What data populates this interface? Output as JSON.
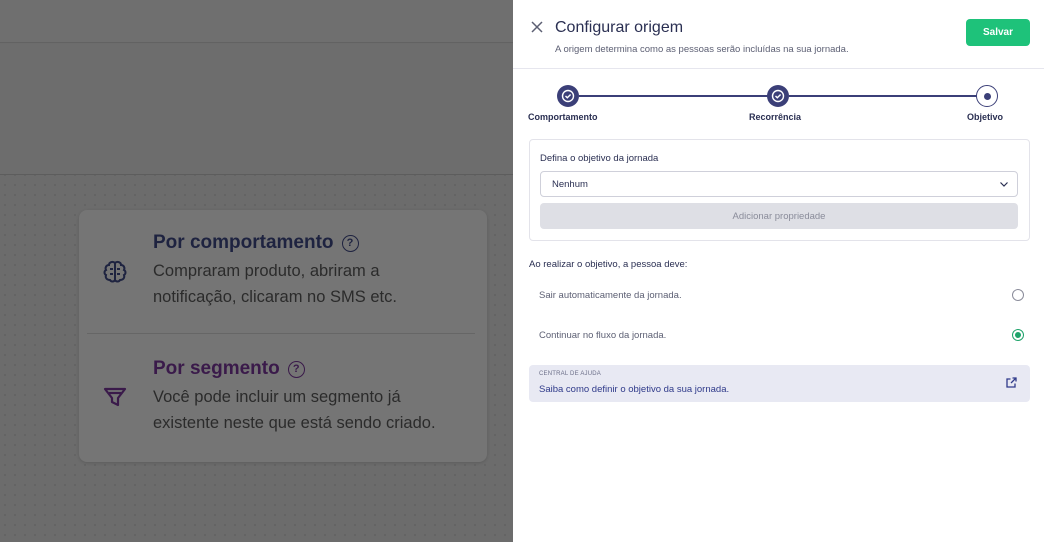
{
  "background": {
    "options": [
      {
        "title": "Por comportamento",
        "description": "Compraram produto, abriram a notificação, clicaram no SMS etc.",
        "icon": "brain-icon"
      },
      {
        "title": "Por segmento",
        "description": "Você pode incluir um segmento já existente neste que está sendo criado.",
        "icon": "funnel-icon"
      }
    ],
    "help_icon": "?"
  },
  "drawer": {
    "title": "Configurar origem",
    "subtitle": "A origem determina como as pessoas serão incluídas na sua jornada.",
    "save_label": "Salvar",
    "steps": [
      {
        "label": "Comportamento",
        "state": "done"
      },
      {
        "label": "Recorrência",
        "state": "done"
      },
      {
        "label": "Objetivo",
        "state": "current"
      }
    ],
    "objective": {
      "label": "Defina o objetivo da jornada",
      "selected": "Nenhum",
      "add_property_label": "Adicionar propriedade"
    },
    "question": "Ao realizar o objetivo, a pessoa deve:",
    "radio_options": [
      {
        "label": "Sair automaticamente da jornada.",
        "checked": false
      },
      {
        "label": "Continuar no fluxo da jornada.",
        "checked": true
      }
    ],
    "help": {
      "kicker": "CENTRAL DE AJUDA",
      "link": "Saiba como definir o objetivo da sua jornada."
    }
  },
  "colors": {
    "accent": "#3b3f78",
    "save": "#1ec27a",
    "radio_checked": "#1ea36a",
    "overlay": "#6c6c6c"
  }
}
